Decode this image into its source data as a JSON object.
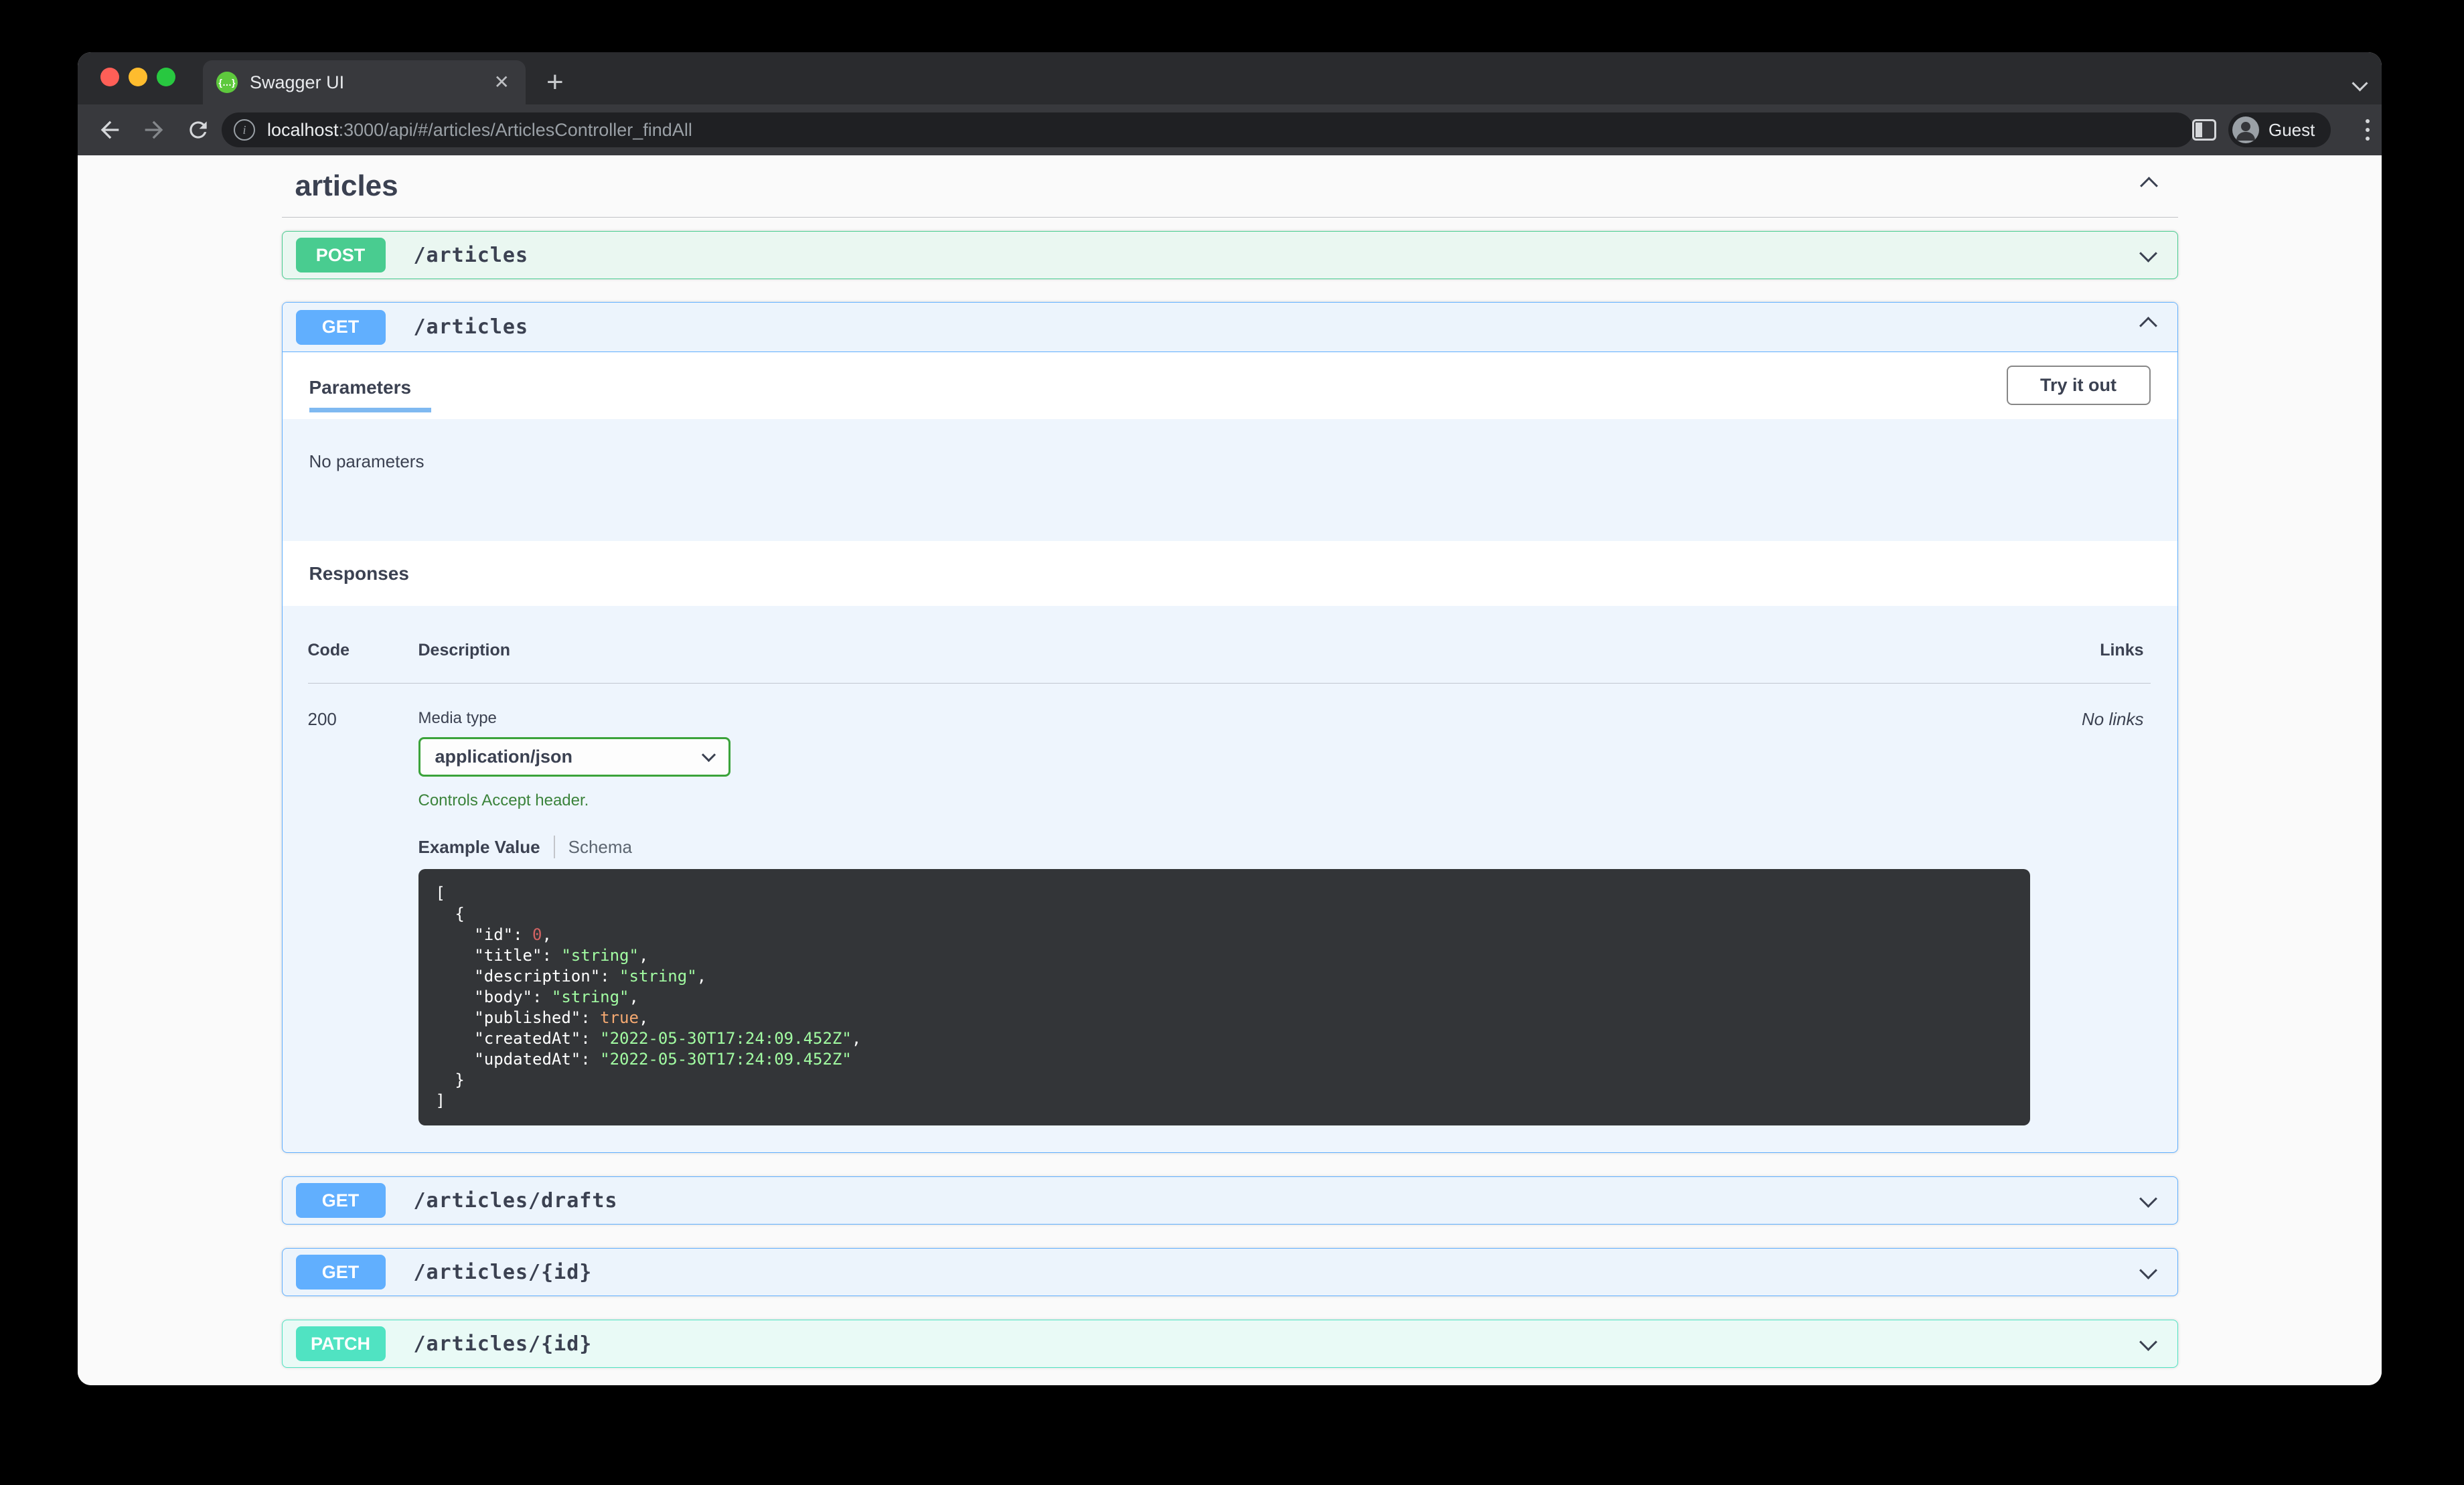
{
  "browser": {
    "window_controls": {
      "close_color": "#ff5f57",
      "minimize_color": "#febc2e",
      "maximize_color": "#28c840"
    },
    "tab": {
      "title": "Swagger UI",
      "favicon": "swagger-logo",
      "close_glyph": "✕"
    },
    "new_tab_glyph": "+",
    "url": {
      "host": "localhost",
      "rest": ":3000/api/#/articles/ArticlesController_findAll"
    },
    "profile_label": "Guest"
  },
  "colors": {
    "post_accent": "#49cc90",
    "get_accent": "#61affe",
    "patch_accent": "#50e3c2",
    "heading_text": "#3b4151",
    "note_green": "#3b833b",
    "code_block_bg": "#333538",
    "code_string": "#a2fca2",
    "code_number": "#d36363",
    "code_boolean": "#f5a971"
  },
  "section": {
    "title": "articles"
  },
  "operations": [
    {
      "method": "POST",
      "path": "/articles",
      "expanded": false
    },
    {
      "method": "GET",
      "path": "/articles",
      "expanded": true
    },
    {
      "method": "GET",
      "path": "/articles/drafts",
      "expanded": false
    },
    {
      "method": "GET",
      "path": "/articles/{id}",
      "expanded": false
    },
    {
      "method": "PATCH",
      "path": "/articles/{id}",
      "expanded": false
    }
  ],
  "get_articles": {
    "parameters_tab": "Parameters",
    "try_it_out": "Try it out",
    "no_parameters": "No parameters",
    "responses_title": "Responses",
    "table": {
      "code_header": "Code",
      "description_header": "Description",
      "links_header": "Links"
    },
    "response": {
      "code": "200",
      "media_type_label": "Media type",
      "media_type_value": "application/json",
      "controls_note": "Controls Accept header.",
      "example_tab": "Example Value",
      "schema_tab": "Schema",
      "links_value": "No links"
    },
    "example_lines": [
      {
        "text": "["
      },
      {
        "text": "  {"
      },
      {
        "indent": "    ",
        "key": "id",
        "value": "0",
        "vtype": "num",
        "comma": true
      },
      {
        "indent": "    ",
        "key": "title",
        "value": "\"string\"",
        "vtype": "str",
        "comma": true
      },
      {
        "indent": "    ",
        "key": "description",
        "value": "\"string\"",
        "vtype": "str",
        "comma": true
      },
      {
        "indent": "    ",
        "key": "body",
        "value": "\"string\"",
        "vtype": "str",
        "comma": true
      },
      {
        "indent": "    ",
        "key": "published",
        "value": "true",
        "vtype": "bool",
        "comma": true
      },
      {
        "indent": "    ",
        "key": "createdAt",
        "value": "\"2022-05-30T17:24:09.452Z\"",
        "vtype": "str",
        "comma": true
      },
      {
        "indent": "    ",
        "key": "updatedAt",
        "value": "\"2022-05-30T17:24:09.452Z\"",
        "vtype": "str",
        "comma": false
      },
      {
        "text": "  }"
      },
      {
        "text": "]"
      }
    ]
  }
}
